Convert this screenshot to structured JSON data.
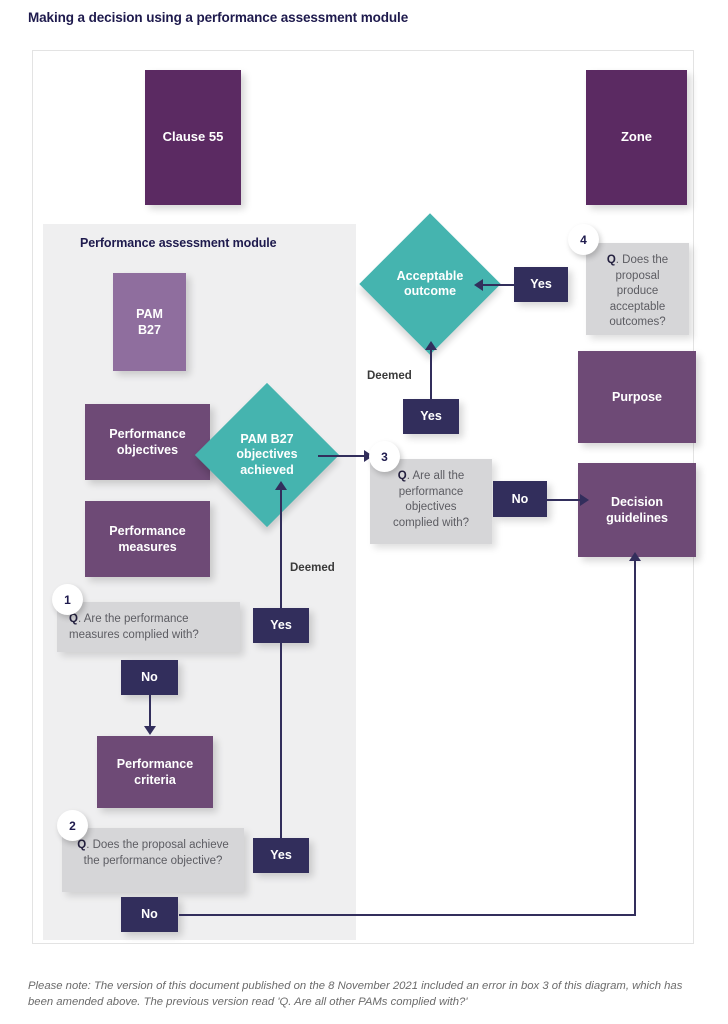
{
  "page": {
    "title": "Making a decision using a performance assessment module",
    "footnote": "Please note: The version of this document published on the 8 November 2021 included an error in box 3 of this diagram, which has been amended above. The previous version read 'Q. Are all other PAMs complied with?'"
  },
  "panel": {
    "title": "Performance assessment module"
  },
  "nodes": {
    "clause55": "Clause 55",
    "zone": "Zone",
    "pam_b27": "PAM\nB27",
    "performance_objectives": "Performance\nobjectives",
    "performance_measures": "Performance\nmeasures",
    "performance_criteria": "Performance\ncriteria",
    "purpose": "Purpose",
    "decision_guidelines": "Decision\nguidelines"
  },
  "diamonds": {
    "pam_b27_objectives_achieved": "PAM B27\nobjectives\nachieved",
    "acceptable_outcome": "Acceptable\noutcome"
  },
  "questions": [
    {
      "number": "1",
      "prefix": "Q",
      "text": ". Are the performance measures complied with?",
      "align": "left"
    },
    {
      "number": "2",
      "prefix": "Q",
      "text": ". Does the proposal achieve the performance objective?",
      "align": "center"
    },
    {
      "number": "3",
      "prefix": "Q",
      "text": ". Are all the performance objectives complied with?",
      "align": "center"
    },
    {
      "number": "4",
      "prefix": "Q",
      "text": ". Does the proposal produce acceptable outcomes?",
      "align": "center"
    }
  ],
  "answers": {
    "q1_yes": "Yes",
    "q1_no": "No",
    "q2_yes": "Yes",
    "q2_no": "No",
    "q3_yes": "Yes",
    "q3_no": "No",
    "q4_yes": "Yes"
  },
  "labels": {
    "deemed_upper": "Deemed",
    "deemed_lower": "Deemed"
  },
  "colors": {
    "dark_purple": "#5b2a62",
    "mid_purple": "#6e4a76",
    "light_purple": "#8f6e9e",
    "teal": "#45b4af",
    "navy": "#322e5c",
    "grey_panel": "#efeff0",
    "grey_callout": "#d6d6d8",
    "title_navy": "#1e1a4d"
  }
}
